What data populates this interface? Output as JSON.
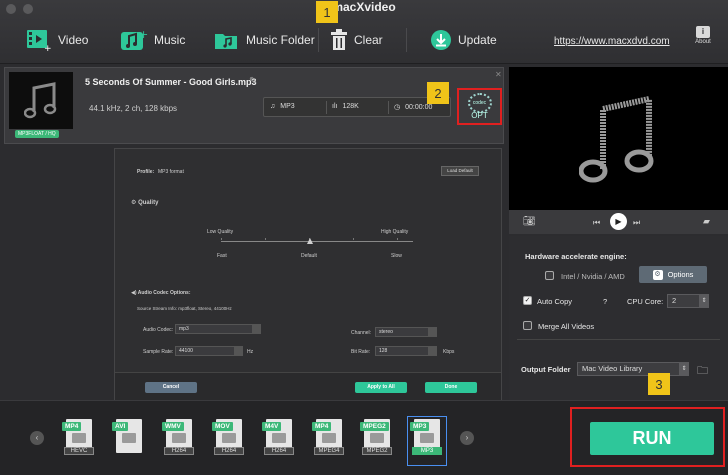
{
  "app": {
    "title": "macXvideo"
  },
  "toolbar": {
    "video": "Video",
    "music": "Music",
    "music_folder": "Music Folder",
    "clear": "Clear",
    "update": "Update",
    "website": "https://www.macxdvd.com",
    "about": "About"
  },
  "badges": {
    "one": "1",
    "two": "2",
    "three": "3"
  },
  "file": {
    "name": "5 Seconds Of Summer - Good Girls.mp3",
    "info": "44.1 kHz, 2 ch, 128 kbps",
    "format_tag": "MP3FLOAT / HQ",
    "out_format": "MP3",
    "bitrate": "128K",
    "duration": "00:00:00",
    "codec_top": "codec",
    "codec_opt": "OPT"
  },
  "codec_panel": {
    "profile_label": "Profile:",
    "profile_value": "MP3 format",
    "load_default": "Load Default",
    "quality": "Quality",
    "low_quality": "Low Quality",
    "high_quality": "High Quality",
    "fast": "Fast",
    "default": "Default",
    "slow": "Slow",
    "audio_codec_options": "Audio Codec Options:",
    "source_stream": "Source Stream Info: mp3float, Stereo, 44100Hz",
    "audio_codec_label": "Audio Codec:",
    "audio_codec_value": "mp3",
    "channel_label": "Channel:",
    "channel_value": "stereo",
    "sample_rate_label": "Sample Rate:",
    "sample_rate_value": "44100",
    "sample_rate_unit": "Hz",
    "bit_rate_label": "Bit Rate:",
    "bit_rate_value": "128",
    "bit_rate_unit": "Kbps",
    "cancel": "Cancel",
    "apply_all": "Apply to All",
    "done": "Done"
  },
  "hardware": {
    "title": "Hardware accelerate engine:",
    "intel": "Intel / Nvidia / AMD",
    "options": "Options",
    "auto_copy": "Auto Copy",
    "help": "?",
    "cpu_core_label": "CPU Core:",
    "cpu_core_value": "2",
    "merge": "Merge All Videos",
    "output_folder_label": "Output Folder",
    "output_folder_value": "Mac Video Library"
  },
  "formats": [
    {
      "top": "MP4",
      "sub": "HEVC"
    },
    {
      "top": "AVI",
      "sub": ""
    },
    {
      "top": "WMV",
      "sub": "H264"
    },
    {
      "top": "MOV",
      "sub": "H264"
    },
    {
      "top": "M4V",
      "sub": "H264"
    },
    {
      "top": "MP4",
      "sub": "MPEG4"
    },
    {
      "top": "MPEG2",
      "sub": "MPEG2"
    },
    {
      "top": "MP3",
      "sub": "MP3"
    }
  ],
  "run": "RUN",
  "colors": {
    "accent_green": "#2ec79a",
    "callout": "#f0c419",
    "highlight_red": "#e02020"
  }
}
